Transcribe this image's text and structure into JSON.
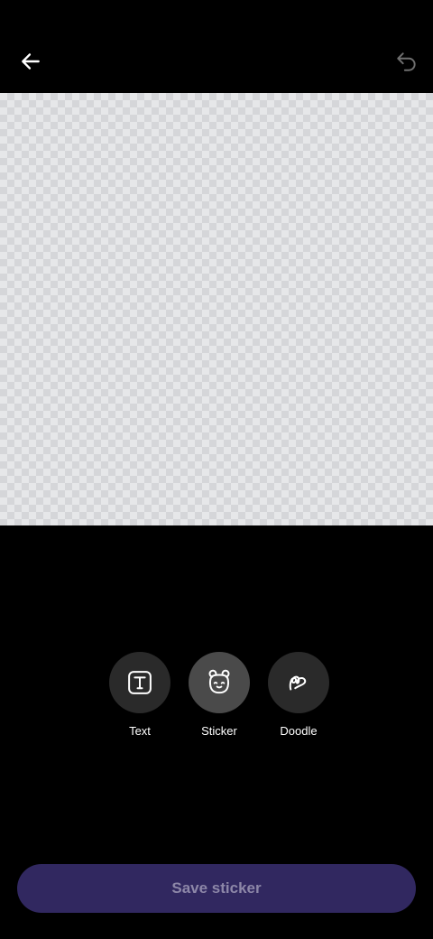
{
  "header": {
    "back_icon": "arrow-left-icon",
    "undo_icon": "undo-icon"
  },
  "canvas": {
    "background": "transparent-checkerboard"
  },
  "tools": [
    {
      "label": "Text",
      "icon": "text-box-icon",
      "selected": false
    },
    {
      "label": "Sticker",
      "icon": "bear-face-icon",
      "selected": true
    },
    {
      "label": "Doodle",
      "icon": "squiggle-icon",
      "selected": false
    }
  ],
  "footer": {
    "save_label": "Save sticker"
  },
  "colors": {
    "background": "#000000",
    "tool_circle": "#2a2a2a",
    "tool_circle_active": "#4a4a4a",
    "save_button": "#312860",
    "save_label": "#8d87a8"
  }
}
